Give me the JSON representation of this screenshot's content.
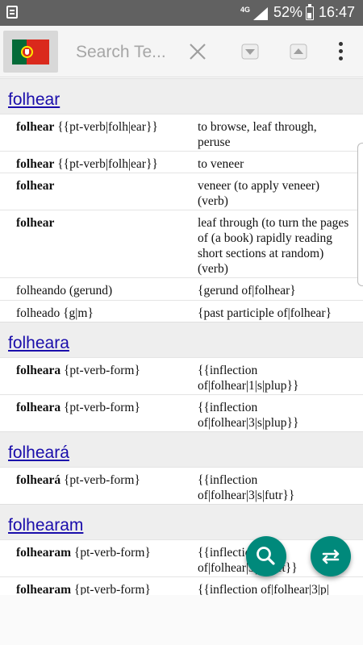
{
  "status_bar": {
    "network": "4G",
    "battery_pct": "52%",
    "time": "16:47"
  },
  "toolbar": {
    "search_placeholder": "Search Te...",
    "language_flag": "portugal-flag-icon",
    "icons": [
      "clear-icon",
      "arrow-down-icon",
      "arrow-up-icon",
      "more-vert-icon"
    ]
  },
  "sections": [
    {
      "word": "folhear",
      "entries": [
        {
          "head": "folhear",
          "meta": " {{pt-verb|folh|ear}}",
          "def": "to browse, leaf through, peruse"
        },
        {
          "head": "folhear",
          "meta": " {{pt-verb|folh|ear}}",
          "def": "to veneer"
        },
        {
          "head": "folhear",
          "meta": "",
          "def": "veneer (to apply veneer) (verb)"
        },
        {
          "head": "folhear",
          "meta": "",
          "def": "leaf through (to turn the pages of (a book) rapidly reading short sections at random) (verb)"
        },
        {
          "head": "",
          "meta": "folheando (gerund)",
          "def": "{gerund of|folhear}"
        },
        {
          "head": "",
          "meta": "folheado {g|m}",
          "def": "{past participle of|folhear}"
        }
      ]
    },
    {
      "word": "folheara",
      "entries": [
        {
          "head": "folheara",
          "meta": " {pt-verb-form}",
          "def": "{{inflection of|folhear|1|s|plup}}"
        },
        {
          "head": "folheara",
          "meta": " {pt-verb-form}",
          "def": "{{inflection of|folhear|3|s|plup}}"
        }
      ]
    },
    {
      "word": "folheará",
      "entries": [
        {
          "head": "folheará",
          "meta": " {pt-verb-form}",
          "def": "{{inflection of|folhear|3|s|futr}}"
        }
      ]
    },
    {
      "word": "folhearam",
      "entries": [
        {
          "head": "folhearam",
          "meta": " {pt-verb-form}",
          "def": "{{inflection of|folhear|3|p|pret}}"
        },
        {
          "head": "folhearam",
          "meta": " {pt-verb-form}",
          "def": "{{inflection of|folhear|3|p|"
        }
      ]
    }
  ],
  "fabs": {
    "search_icon": "search-icon",
    "swap_icon": "swap-icon",
    "color": "#00897b"
  }
}
